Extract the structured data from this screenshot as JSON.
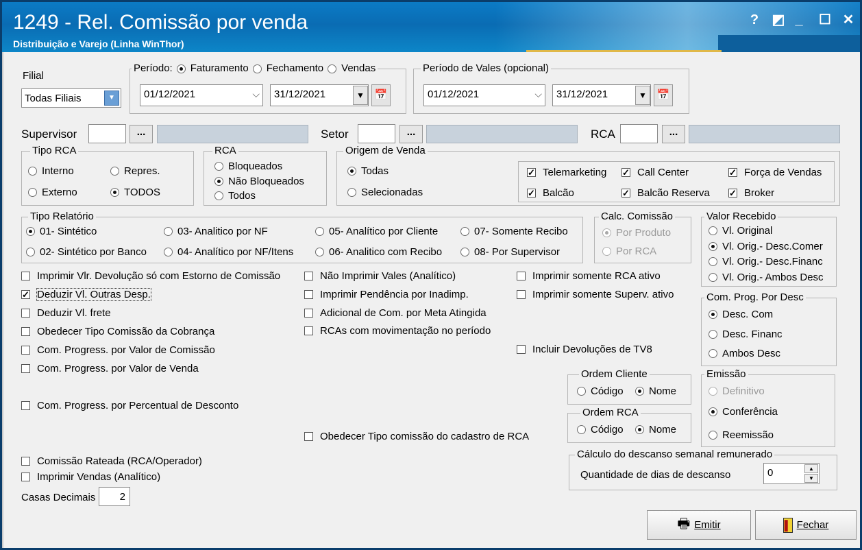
{
  "window": {
    "title": "1249 - Rel. Comissão por venda",
    "subtitle": "Distribuição e Varejo (Linha WinThor)",
    "help": "?",
    "restore": "◩",
    "minimize": "_",
    "maximize": "☐",
    "close": "✕"
  },
  "filial": {
    "label": "Filial",
    "value": "Todas Filiais"
  },
  "periodo": {
    "label": "Período:",
    "options": [
      "Faturamento",
      "Fechamento",
      "Vendas"
    ],
    "selected": "Faturamento",
    "start": "01/12/2021",
    "end": "31/12/2021"
  },
  "vales": {
    "label": "Período de Vales (opcional)",
    "start": "01/12/2021",
    "end": "31/12/2021"
  },
  "lookups": {
    "supervisor": "Supervisor",
    "setor": "Setor",
    "rca": "RCA",
    "ellipsis": "..."
  },
  "tipo_rca": {
    "legend": "Tipo RCA",
    "options": [
      "Interno",
      "Repres.",
      "Externo",
      "TODOS"
    ],
    "selected": "TODOS"
  },
  "rca_status": {
    "legend": "RCA",
    "options": [
      "Bloqueados",
      "Não Bloqueados",
      "Todos"
    ],
    "selected": "Não Bloqueados"
  },
  "origem": {
    "legend": "Origem de Venda",
    "options": [
      "Todas",
      "Selecionadas"
    ],
    "selected": "Todas",
    "checks": [
      "Telemarketing",
      "Call Center",
      "Força de Vendas",
      "Balcão",
      "Balcão Reserva",
      "Broker"
    ]
  },
  "tipo_relatorio": {
    "legend": "Tipo Relatório",
    "options": [
      "01- Sintético",
      "02- Sintético por Banco",
      "03- Analitico por NF",
      "04- Analítico por NF/Itens",
      "05- Analítico por Cliente",
      "06- Analitico com Recibo",
      "07- Somente Recibo",
      "08- Por Supervisor"
    ],
    "selected": "01- Sintético"
  },
  "calc_comissao": {
    "legend": "Calc. Comissão",
    "options": [
      "Por Produto",
      "Por RCA"
    ],
    "selected": "Por Produto"
  },
  "valor_recebido": {
    "legend": "Valor Recebido",
    "options": [
      "Vl. Original",
      "Vl. Orig.- Desc.Comer",
      "Vl. Orig.- Desc.Financ",
      "Vl. Orig.- Ambos Desc"
    ],
    "selected": "Vl. Orig.- Desc.Comer"
  },
  "com_prog": {
    "legend": "Com. Prog. Por Desc",
    "options": [
      "Desc. Com",
      "Desc. Financ",
      "Ambos Desc"
    ],
    "selected": "Desc. Com"
  },
  "checks_left": [
    "Imprimir Vlr. Devolução só com Estorno de Comissão",
    "Deduzir Vl. Outras Desp.",
    "Deduzir Vl. frete",
    "Obedecer Tipo Comissão da Cobrança",
    "Com. Progress. por Valor de Comissão",
    "Com. Progress. por Valor de Venda",
    "Com. Progress. por Percentual de Desconto",
    "Comissão Rateada (RCA/Operador)",
    "Imprimir Vendas (Analítico)"
  ],
  "checks_mid": [
    "Não Imprimir Vales (Analítico)",
    "Imprimir Pendência por Inadimp.",
    "Adicional de Com. por Meta Atingida",
    "RCAs com movimentação no período",
    "Obedecer Tipo comissão do cadastro de RCA"
  ],
  "checks_right": [
    "Imprimir somente RCA ativo",
    "Imprimir somente Superv. ativo",
    "Incluir Devoluções de TV8"
  ],
  "ordem_cliente": {
    "legend": "Ordem Cliente",
    "options": [
      "Código",
      "Nome"
    ],
    "selected": "Nome"
  },
  "ordem_rca": {
    "legend": "Ordem RCA",
    "options": [
      "Código",
      "Nome"
    ],
    "selected": "Nome"
  },
  "emissao": {
    "legend": "Emissão",
    "options": [
      "Definitivo",
      "Conferência",
      "Reemissão"
    ],
    "selected": "Conferência"
  },
  "descanso": {
    "legend": "Cálculo do descanso semanal remunerado",
    "label": "Quantidade de dias de descanso",
    "value": "0"
  },
  "casas": {
    "label": "Casas Decimais",
    "value": "2"
  },
  "buttons": {
    "emitir": "Emitir",
    "fechar": "Fechar"
  }
}
